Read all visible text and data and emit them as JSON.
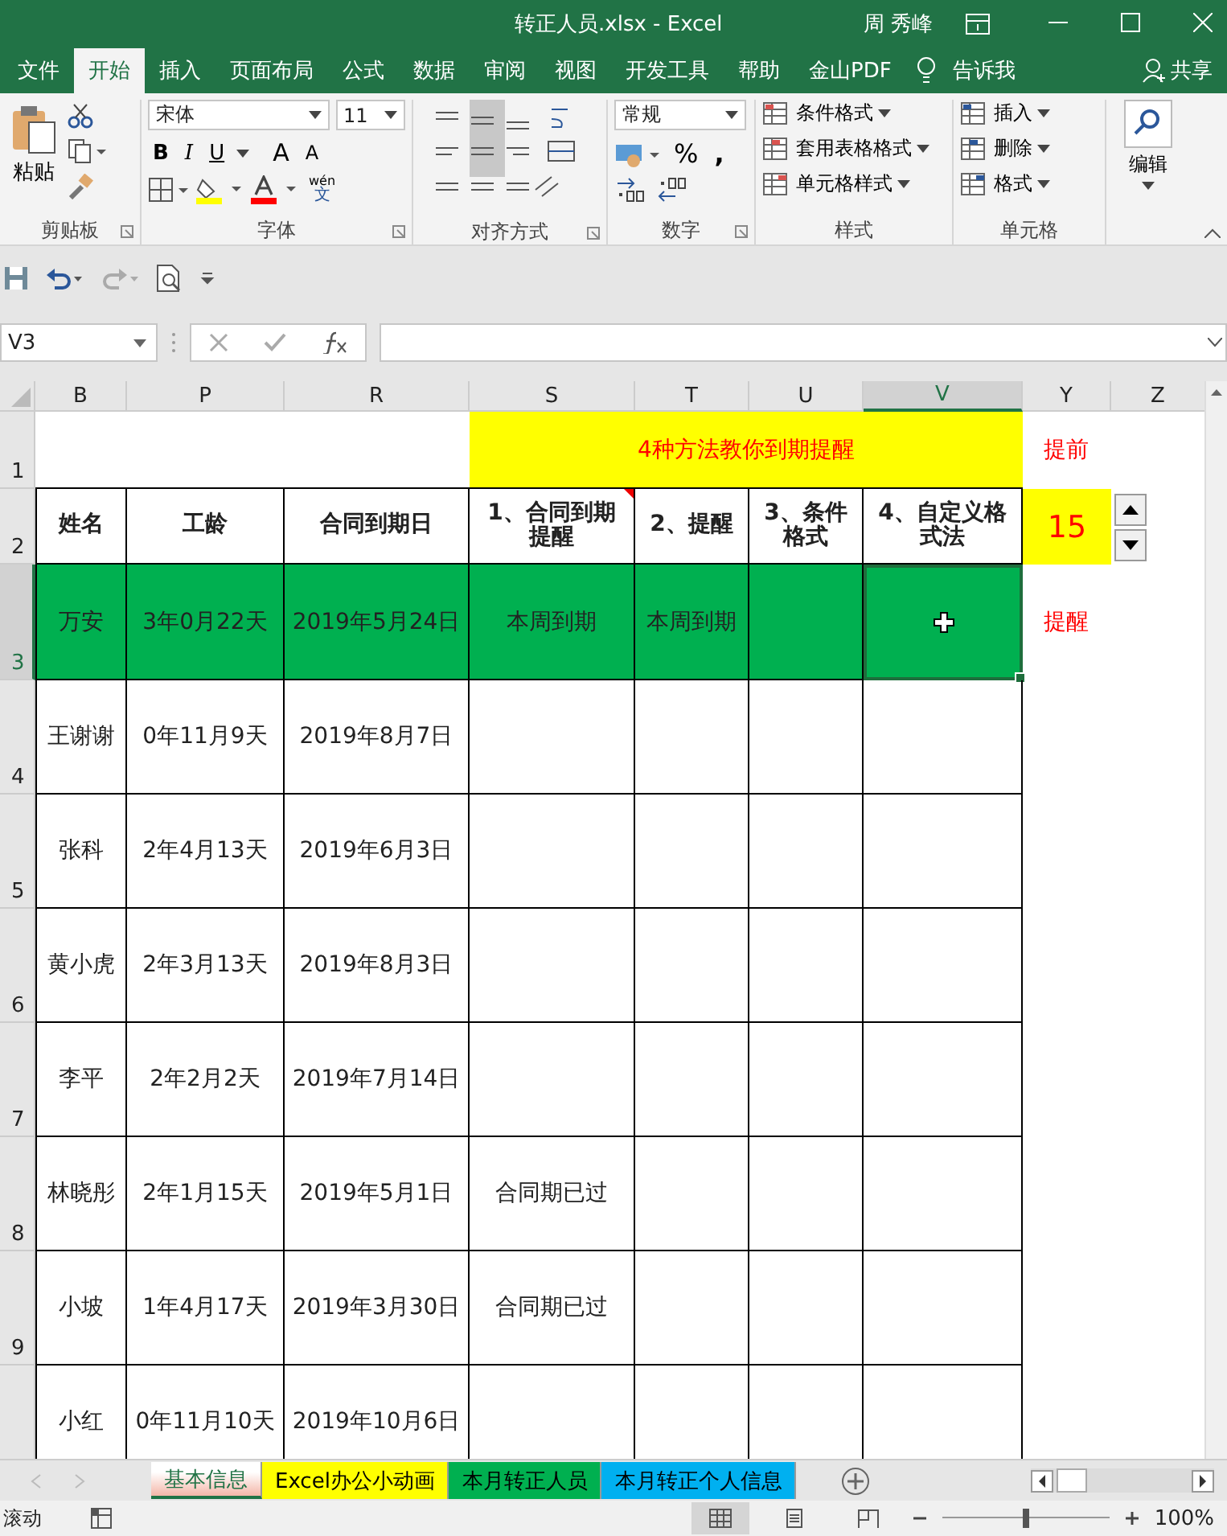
{
  "window": {
    "title": "转正人员.xlsx  -  Excel",
    "user": "周 秀峰"
  },
  "menu_tabs": [
    {
      "label": "文件",
      "selected": false
    },
    {
      "label": "开始",
      "selected": true
    },
    {
      "label": "插入",
      "selected": false
    },
    {
      "label": "页面布局",
      "selected": false
    },
    {
      "label": "公式",
      "selected": false
    },
    {
      "label": "数据",
      "selected": false
    },
    {
      "label": "审阅",
      "selected": false
    },
    {
      "label": "视图",
      "selected": false
    },
    {
      "label": "开发工具",
      "selected": false
    },
    {
      "label": "帮助",
      "selected": false
    },
    {
      "label": "金山PDF",
      "selected": false
    }
  ],
  "tell_me": "告诉我",
  "share": "共享",
  "ribbon": [
    {
      "kind": "clipboard",
      "label": "剪贴板",
      "paste": "粘贴"
    },
    {
      "kind": "font",
      "label": "字体",
      "font": "宋体",
      "size": "11",
      "bold": "B",
      "italic": "I",
      "underline": "U",
      "grow": "A",
      "shrink": "A",
      "phonetic_top": "wén",
      "phonetic_bottom": "文"
    },
    {
      "kind": "alignment",
      "label": "对齐方式"
    },
    {
      "kind": "number",
      "label": "数字",
      "format": "常规",
      "percent": "%",
      "comma": ","
    },
    {
      "kind": "styles",
      "label": "样式",
      "items": [
        "条件格式",
        "套用表格格式",
        "单元格样式"
      ]
    },
    {
      "kind": "cells",
      "label": "单元格",
      "items": [
        "插入",
        "删除",
        "格式"
      ]
    },
    {
      "kind": "editing",
      "label": "编辑"
    }
  ],
  "name_box": "V3",
  "columns": [
    {
      "label": "B",
      "selected": false
    },
    {
      "label": "P",
      "selected": false
    },
    {
      "label": "R",
      "selected": false
    },
    {
      "label": "S",
      "selected": false
    },
    {
      "label": "T",
      "selected": false
    },
    {
      "label": "U",
      "selected": false
    },
    {
      "label": "V",
      "selected": true
    },
    {
      "label": "Y",
      "selected": false
    },
    {
      "label": "Z",
      "selected": false
    }
  ],
  "title_row": {
    "row_number": "1",
    "title": "4种方法教你到期提醒",
    "note": "提前"
  },
  "header_row": {
    "row_number": "2",
    "advance_days": "15",
    "cells": [
      {
        "text": "姓名",
        "comment": false
      },
      {
        "text": "工龄",
        "comment": false
      },
      {
        "text": "合同到期日",
        "comment": false
      },
      {
        "text": "1、合同到期提醒",
        "comment": true
      },
      {
        "text": "2、提醒",
        "comment": false
      },
      {
        "text": "3、条件格式",
        "comment": false
      },
      {
        "text": "4、自定义格式法",
        "comment": false
      }
    ]
  },
  "rows": [
    {
      "row_number": "3",
      "selected": true,
      "highlighted": true,
      "note": "提醒",
      "cells": [
        "万安",
        "3年0月22天",
        "2019年5月24日",
        "本周到期",
        "本周到期",
        null,
        null
      ]
    },
    {
      "row_number": "4",
      "selected": false,
      "highlighted": false,
      "cells": [
        "王谢谢",
        "0年11月9天",
        "2019年8月7日",
        null,
        null,
        null,
        null
      ]
    },
    {
      "row_number": "5",
      "selected": false,
      "highlighted": false,
      "cells": [
        "张科",
        "2年4月13天",
        "2019年6月3日",
        null,
        null,
        null,
        null
      ]
    },
    {
      "row_number": "6",
      "selected": false,
      "highlighted": false,
      "cells": [
        "黄小虎",
        "2年3月13天",
        "2019年8月3日",
        null,
        null,
        null,
        null
      ]
    },
    {
      "row_number": "7",
      "selected": false,
      "highlighted": false,
      "cells": [
        "李平",
        "2年2月2天",
        "2019年7月14日",
        null,
        null,
        null,
        null
      ]
    },
    {
      "row_number": "8",
      "selected": false,
      "highlighted": false,
      "cells": [
        "林晓彤",
        "2年1月15天",
        "2019年5月1日",
        "合同期已过",
        null,
        null,
        null
      ]
    },
    {
      "row_number": "9",
      "selected": false,
      "highlighted": false,
      "cells": [
        "小坡",
        "1年4月17天",
        "2019年3月30日",
        "合同期已过",
        null,
        null,
        null
      ]
    },
    {
      "selected": false,
      "highlighted": false,
      "cells": [
        "小红",
        "0年11月10天",
        "2019年10月6日",
        null,
        null,
        null,
        null
      ]
    }
  ],
  "sheet_tabs": [
    {
      "label": "基本信息",
      "color": "#f4b6a8",
      "selected": true
    },
    {
      "label": "Excel办公小动画",
      "color": "#ffff00",
      "selected": false
    },
    {
      "label": "本月转正人员",
      "color": "#00b050",
      "selected": false
    },
    {
      "label": "本月转正个人信息",
      "color": "#00b0f0",
      "selected": false
    }
  ],
  "status": {
    "mode": "滚动",
    "zoom": "100%",
    "zoom_slider": {
      "level": 0.5
    }
  }
}
